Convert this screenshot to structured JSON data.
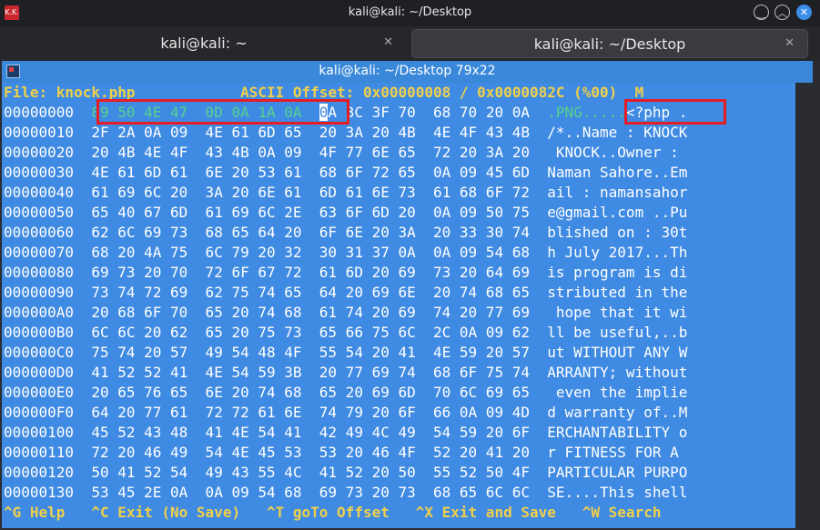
{
  "window": {
    "title": "kali@kali: ~/Desktop",
    "app_icon_text": "K.K."
  },
  "tabs": [
    {
      "label": "kali@kali: ~",
      "active": false
    },
    {
      "label": "kali@kali: ~/Desktop",
      "active": true
    }
  ],
  "terminal": {
    "title": "kali@kali: ~/Desktop 79x22",
    "status": "File: knock.php            ASCII Offset: 0x00000008 / 0x0000082C (%00)  M",
    "rows": [
      {
        "off": "00000000",
        "hexA": "89 50 4E 47  0D 0A 1A 0A",
        "cursorChar": "0",
        "hexB": "A 3C 3F 70  68 70 20 0A",
        "asciiA": ".PNG.....",
        "asciiB": "<?php ."
      },
      {
        "off": "00000010",
        "hex": "2F 2A 0A 09  4E 61 6D 65  20 3A 20 4B  4E 4F 43 4B",
        "ascii": "/*..Name : KNOCK"
      },
      {
        "off": "00000020",
        "hex": "20 4B 4E 4F  43 4B 0A 09  4F 77 6E 65  72 20 3A 20",
        "ascii": " KNOCK..Owner : "
      },
      {
        "off": "00000030",
        "hex": "4E 61 6D 61  6E 20 53 61  68 6F 72 65  0A 09 45 6D",
        "ascii": "Naman Sahore..Em"
      },
      {
        "off": "00000040",
        "hex": "61 69 6C 20  3A 20 6E 61  6D 61 6E 73  61 68 6F 72",
        "ascii": "ail : namansahor"
      },
      {
        "off": "00000050",
        "hex": "65 40 67 6D  61 69 6C 2E  63 6F 6D 20  0A 09 50 75",
        "ascii": "e@gmail.com ..Pu"
      },
      {
        "off": "00000060",
        "hex": "62 6C 69 73  68 65 64 20  6F 6E 20 3A  20 33 30 74",
        "ascii": "blished on : 30t"
      },
      {
        "off": "00000070",
        "hex": "68 20 4A 75  6C 79 20 32  30 31 37 0A  0A 09 54 68",
        "ascii": "h July 2017...Th"
      },
      {
        "off": "00000080",
        "hex": "69 73 20 70  72 6F 67 72  61 6D 20 69  73 20 64 69",
        "ascii": "is program is di"
      },
      {
        "off": "00000090",
        "hex": "73 74 72 69  62 75 74 65  64 20 69 6E  20 74 68 65",
        "ascii": "stributed in the"
      },
      {
        "off": "000000A0",
        "hex": "20 68 6F 70  65 20 74 68  61 74 20 69  74 20 77 69",
        "ascii": " hope that it wi"
      },
      {
        "off": "000000B0",
        "hex": "6C 6C 20 62  65 20 75 73  65 66 75 6C  2C 0A 09 62",
        "ascii": "ll be useful,..b"
      },
      {
        "off": "000000C0",
        "hex": "75 74 20 57  49 54 48 4F  55 54 20 41  4E 59 20 57",
        "ascii": "ut WITHOUT ANY W"
      },
      {
        "off": "000000D0",
        "hex": "41 52 52 41  4E 54 59 3B  20 77 69 74  68 6F 75 74",
        "ascii": "ARRANTY; without"
      },
      {
        "off": "000000E0",
        "hex": "20 65 76 65  6E 20 74 68  65 20 69 6D  70 6C 69 65",
        "ascii": " even the implie"
      },
      {
        "off": "000000F0",
        "hex": "64 20 77 61  72 72 61 6E  74 79 20 6F  66 0A 09 4D",
        "ascii": "d warranty of..M"
      },
      {
        "off": "00000100",
        "hex": "45 52 43 48  41 4E 54 41  42 49 4C 49  54 59 20 6F",
        "ascii": "ERCHANTABILITY o"
      },
      {
        "off": "00000110",
        "hex": "72 20 46 49  54 4E 45 53  53 20 46 4F  52 20 41 20",
        "ascii": "r FITNESS FOR A "
      },
      {
        "off": "00000120",
        "hex": "50 41 52 54  49 43 55 4C  41 52 20 50  55 52 50 4F",
        "ascii": "PARTICULAR PURPO"
      },
      {
        "off": "00000130",
        "hex": "53 45 2E 0A  0A 09 54 68  69 73 20 73  68 65 6C 6C",
        "ascii": "SE....This shell"
      }
    ],
    "help": "^G Help   ^C Exit (No Save)   ^T goTo Offset   ^X Exit and Save   ^W Search"
  },
  "colors": {
    "terminal_bg": "#3f8ae2",
    "highlight_box": "#e31e24",
    "status_text": "#f0d04a"
  }
}
